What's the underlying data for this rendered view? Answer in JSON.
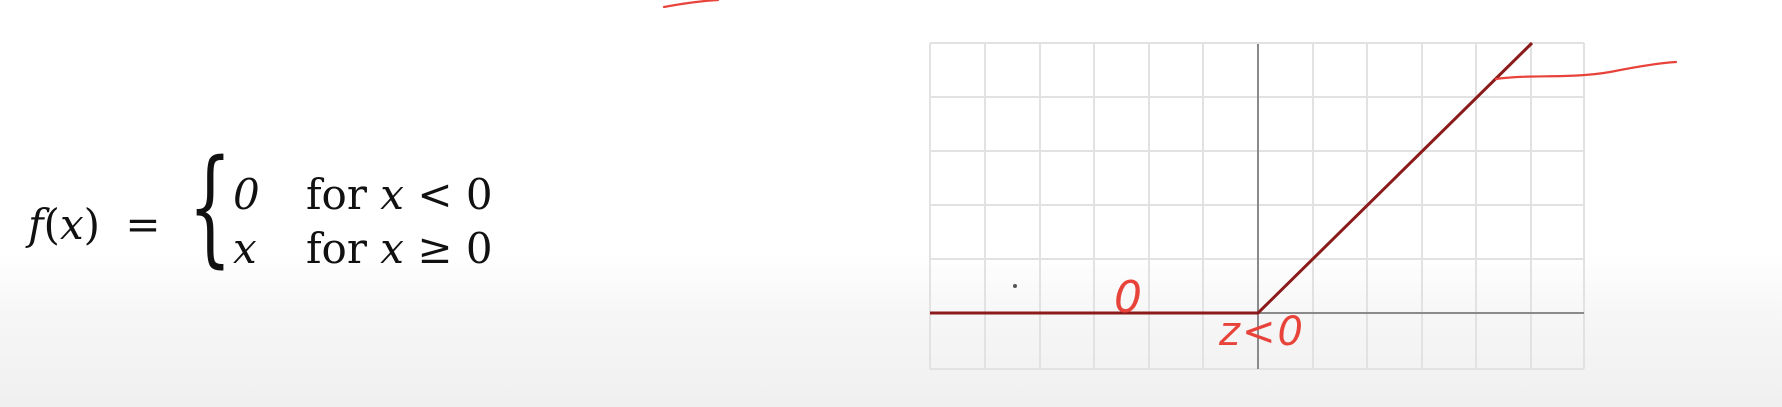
{
  "formula": {
    "lhs_func": "f",
    "lhs_paren_open": "(",
    "lhs_var": "x",
    "lhs_paren_close": ")",
    "equals": "=",
    "cases": [
      {
        "value": "0",
        "word": "for",
        "var": "x",
        "relation": "< 0"
      },
      {
        "value": "x",
        "word": "for",
        "var": "x",
        "relation": "≥ 0"
      }
    ]
  },
  "graph": {
    "function": "relu",
    "grid": true,
    "colors": {
      "function_line": "#8b1a1a",
      "annotation": "#e8433a",
      "grid": "#e2e2e2",
      "axis": "#8a8a8a"
    }
  },
  "annotations": {
    "zero_label": "0",
    "z_label": "z<0"
  }
}
